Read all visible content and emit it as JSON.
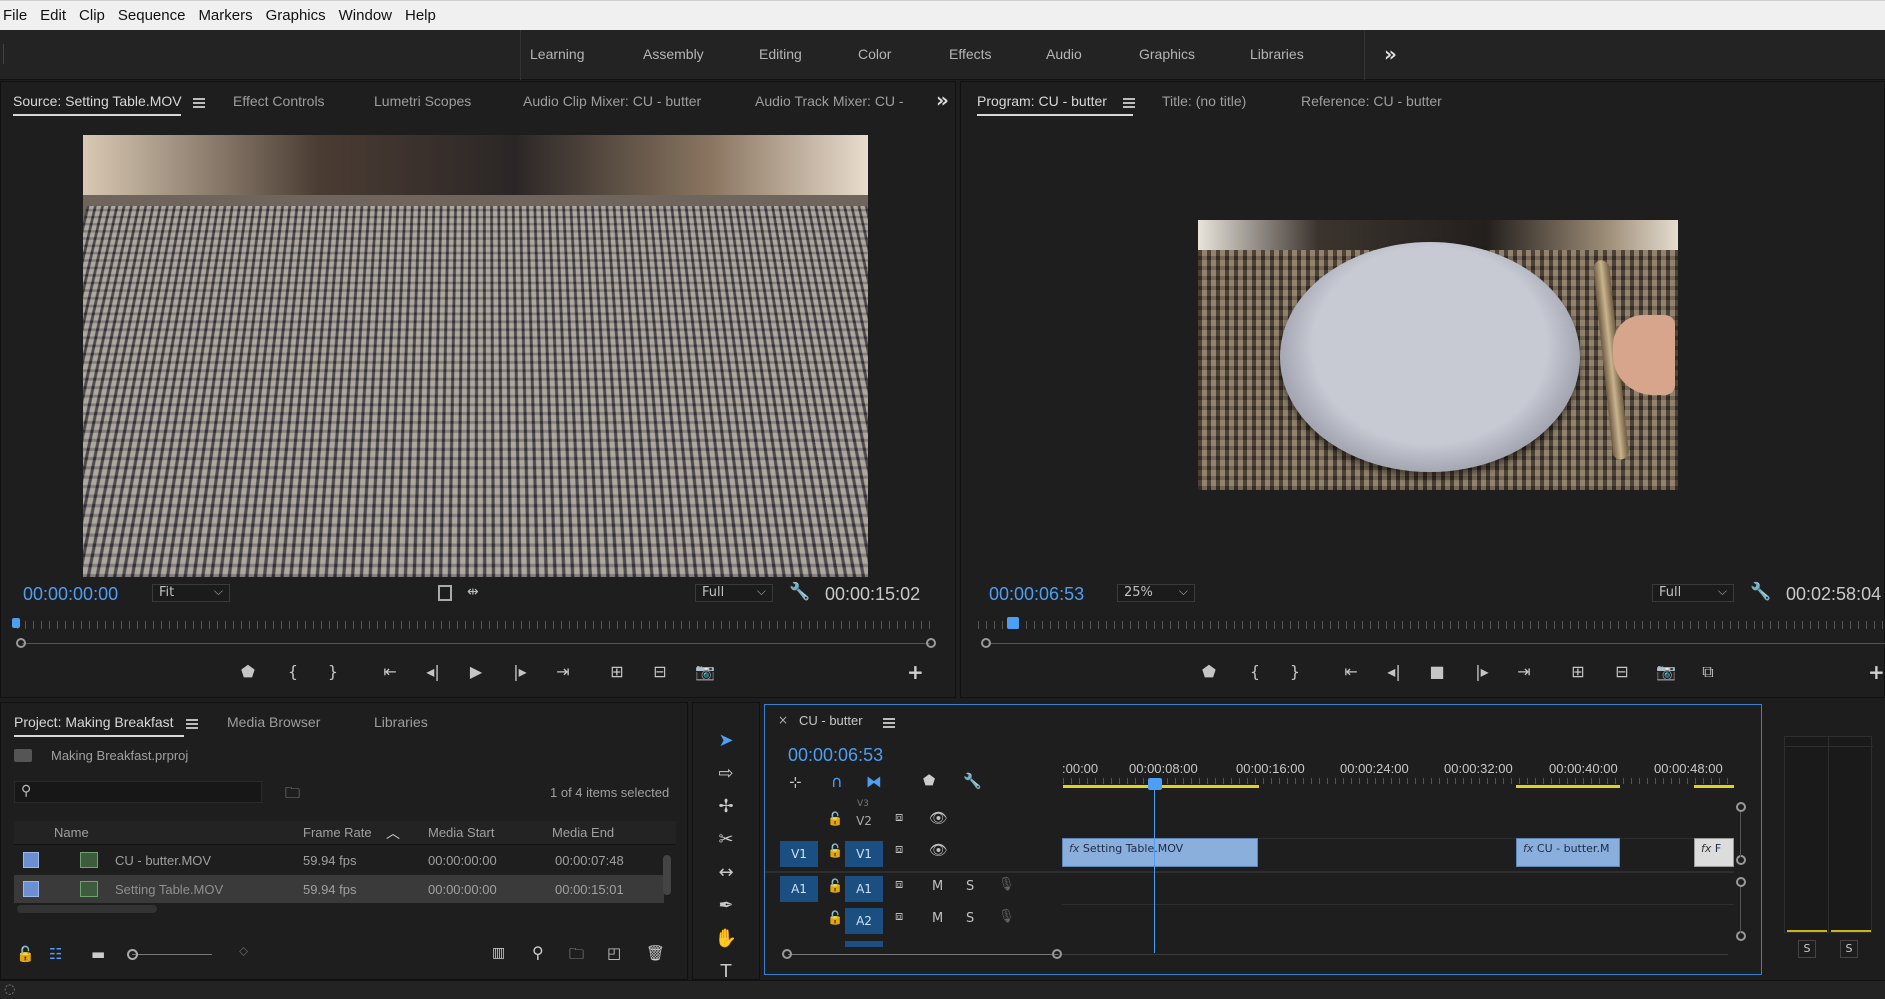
{
  "menu": [
    "File",
    "Edit",
    "Clip",
    "Sequence",
    "Markers",
    "Graphics",
    "Window",
    "Help"
  ],
  "workspaces": [
    "Learning",
    "Assembly",
    "Editing",
    "Color",
    "Effects",
    "Audio",
    "Graphics",
    "Libraries"
  ],
  "source_panel": {
    "tabs": [
      "Source: Setting Table.MOV",
      "Effect Controls",
      "Lumetri Scopes",
      "Audio Clip Mixer: CU - butter",
      "Audio Track Mixer: CU - b"
    ],
    "timecode": "00:00:00:00",
    "zoom": "Fit",
    "resolution": "Full",
    "duration": "00:00:15:02"
  },
  "program_panel": {
    "tabs": [
      "Program: CU - butter",
      "Title: (no title)",
      "Reference: CU - butter"
    ],
    "timecode": "00:00:06:53",
    "zoom": "25%",
    "resolution": "Full",
    "duration": "00:02:58:04"
  },
  "project_panel": {
    "tabs": [
      "Project: Making Breakfast",
      "Media Browser",
      "Libraries"
    ],
    "project_file": "Making Breakfast.prproj",
    "selection_status": "1 of 4 items selected",
    "columns": [
      "Name",
      "Frame Rate",
      "Media Start",
      "Media End"
    ],
    "rows": [
      {
        "name": "CU - butter.MOV",
        "frame_rate": "59.94 fps",
        "start": "00:00:00:00",
        "end": "00:00:07:48"
      },
      {
        "name": "Setting Table.MOV",
        "frame_rate": "59.94 fps",
        "start": "00:00:00:00",
        "end": "00:00:15:01"
      }
    ]
  },
  "timeline": {
    "sequence_name": "CU - butter",
    "timecode": "00:00:06:53",
    "ruler": [
      ":00:00",
      "00:00:08:00",
      "00:00:16:00",
      "00:00:24:00",
      "00:00:32:00",
      "00:00:40:00",
      "00:00:48:00"
    ],
    "tracks": {
      "v3": "V3",
      "v2": "V2",
      "v1_src": "V1",
      "v1": "V1",
      "a1_src": "A1",
      "a1": "A1",
      "a2": "A2"
    },
    "mute": "M",
    "solo": "S",
    "clips": [
      {
        "name": "Setting Table.MOV"
      },
      {
        "name": "CU - butter.M"
      },
      {
        "name": "F"
      }
    ]
  },
  "meter": {
    "solo_left": "S",
    "solo_right": "S"
  },
  "colors": {
    "accent": "#4d9ef5",
    "clip": "#8aafdd",
    "track_blue": "#1b4f82"
  }
}
